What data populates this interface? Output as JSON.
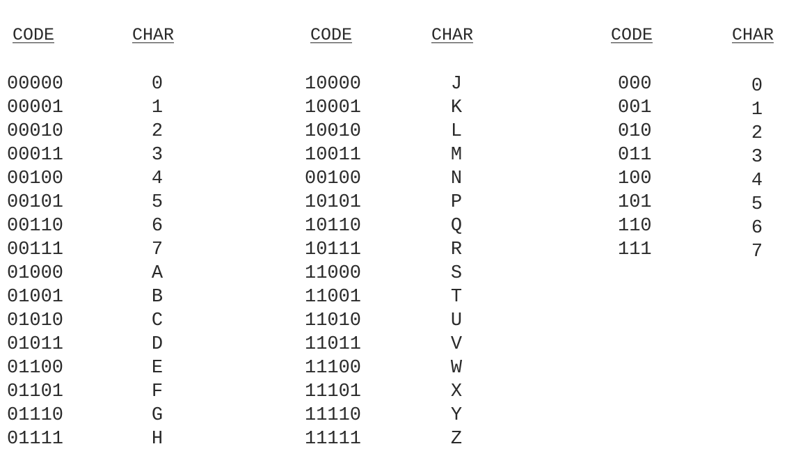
{
  "tables": [
    {
      "code_header": "CODE",
      "char_header": "CHAR",
      "rows": [
        {
          "code": "00000",
          "char": "0"
        },
        {
          "code": "00001",
          "char": "1"
        },
        {
          "code": "00010",
          "char": "2"
        },
        {
          "code": "00011",
          "char": "3"
        },
        {
          "code": "00100",
          "char": "4"
        },
        {
          "code": "00101",
          "char": "5"
        },
        {
          "code": "00110",
          "char": "6"
        },
        {
          "code": "00111",
          "char": "7"
        },
        {
          "code": "01000",
          "char": "A"
        },
        {
          "code": "01001",
          "char": "B"
        },
        {
          "code": "01010",
          "char": "C"
        },
        {
          "code": "01011",
          "char": "D"
        },
        {
          "code": "01100",
          "char": "E"
        },
        {
          "code": "01101",
          "char": "F"
        },
        {
          "code": "01110",
          "char": "G"
        },
        {
          "code": "01111",
          "char": "H"
        }
      ]
    },
    {
      "code_header": "CODE",
      "char_header": "CHAR",
      "rows": [
        {
          "code": "10000",
          "char": "J"
        },
        {
          "code": "10001",
          "char": "K"
        },
        {
          "code": "10010",
          "char": "L"
        },
        {
          "code": "10011",
          "char": "M"
        },
        {
          "code": "00100",
          "char": "N"
        },
        {
          "code": "10101",
          "char": "P"
        },
        {
          "code": "10110",
          "char": "Q"
        },
        {
          "code": "10111",
          "char": "R"
        },
        {
          "code": "11000",
          "char": "S"
        },
        {
          "code": "11001",
          "char": "T"
        },
        {
          "code": "11010",
          "char": "U"
        },
        {
          "code": "11011",
          "char": "V"
        },
        {
          "code": "11100",
          "char": "W"
        },
        {
          "code": "11101",
          "char": "X"
        },
        {
          "code": "11110",
          "char": "Y"
        },
        {
          "code": "11111",
          "char": "Z"
        }
      ]
    },
    {
      "code_header": "CODE",
      "char_header": "CHAR",
      "rows": [
        {
          "code": "000",
          "char": "0"
        },
        {
          "code": "001",
          "char": "1"
        },
        {
          "code": "010",
          "char": "2"
        },
        {
          "code": "011",
          "char": "3"
        },
        {
          "code": "100",
          "char": "4"
        },
        {
          "code": "101",
          "char": "5"
        },
        {
          "code": "110",
          "char": "6"
        },
        {
          "code": "111",
          "char": "7"
        }
      ]
    }
  ]
}
